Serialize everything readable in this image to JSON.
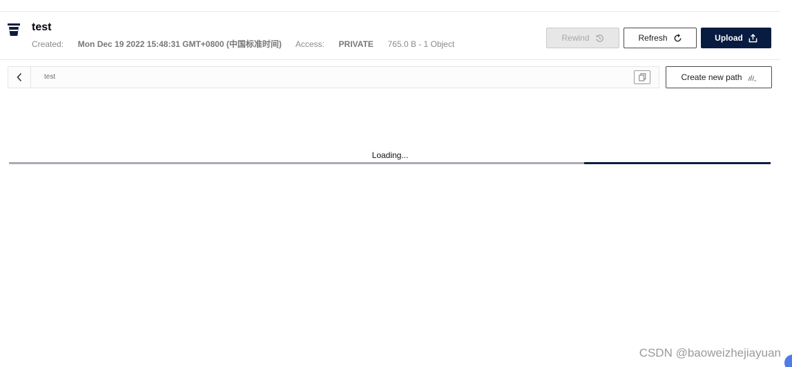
{
  "bucket": {
    "title": "test",
    "created_label": "Created:",
    "created_value": "Mon Dec 19 2022 15:48:31 GMT+0800 (中国标准时间)",
    "access_label": "Access:",
    "access_value": "PRIVATE",
    "size_summary": "765.0 B - 1 Object",
    "icon": "bucket-icon"
  },
  "toolbar": {
    "rewind_label": "Rewind",
    "refresh_label": "Refresh",
    "upload_label": "Upload"
  },
  "path_bar": {
    "back_icon": "chevron-left-icon",
    "crumb": "test",
    "copy_icon": "copy-icon",
    "create_new_path_label": "Create new path"
  },
  "loading": {
    "text": "Loading...",
    "progress_fraction": 0.245
  },
  "watermark": "CSDN @baoweizhejiayuan",
  "colors": {
    "primary": "#081c42",
    "disabled_bg": "#e7e7e7",
    "progress_track": "#a7abb3"
  }
}
